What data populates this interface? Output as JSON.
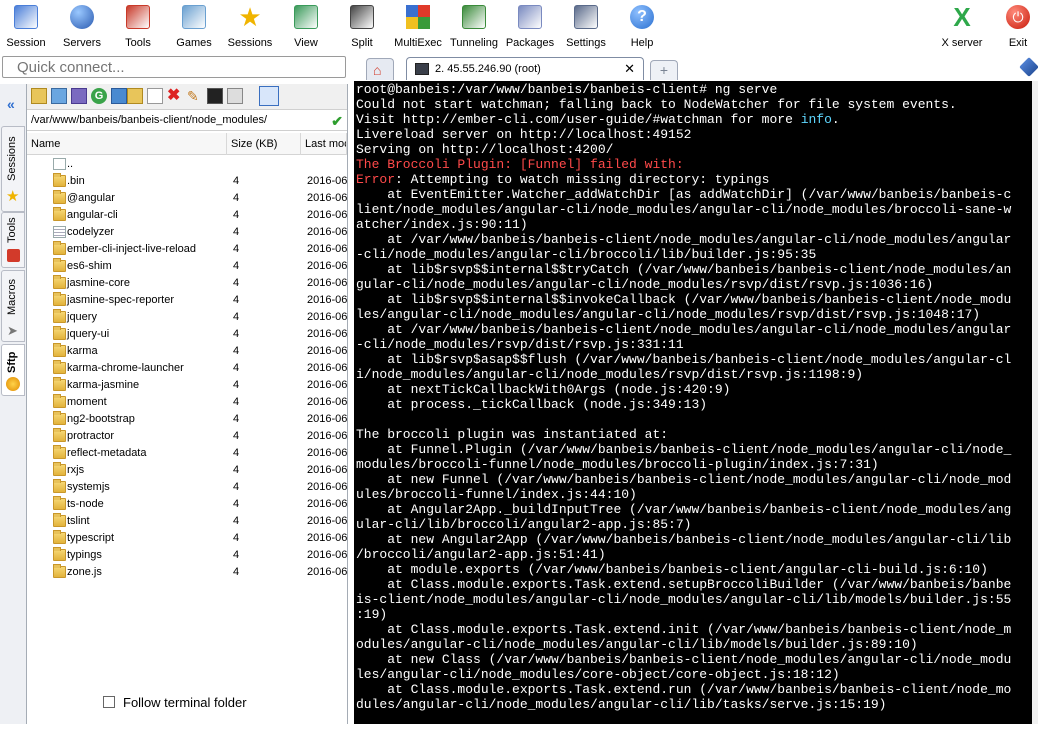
{
  "toolbar": [
    {
      "label": "Session",
      "icon": "session-icon"
    },
    {
      "label": "Servers",
      "icon": "servers-icon"
    },
    {
      "label": "Tools",
      "icon": "tools-icon"
    },
    {
      "label": "Games",
      "icon": "games-icon"
    },
    {
      "label": "Sessions",
      "icon": "star-icon"
    },
    {
      "label": "View",
      "icon": "view-icon"
    },
    {
      "label": "Split",
      "icon": "split-icon"
    },
    {
      "label": "MultiExec",
      "icon": "multiexec-icon"
    },
    {
      "label": "Tunneling",
      "icon": "tunneling-icon"
    },
    {
      "label": "Packages",
      "icon": "packages-icon"
    },
    {
      "label": "Settings",
      "icon": "settings-icon"
    },
    {
      "label": "Help",
      "icon": "help-icon"
    }
  ],
  "toolbar_right": [
    {
      "label": "X server",
      "icon": "x-server-icon"
    },
    {
      "label": "Exit",
      "icon": "exit-icon"
    }
  ],
  "quick_connect": {
    "placeholder": "Quick connect..."
  },
  "side_tabs": [
    "Sessions",
    "Tools",
    "Macros",
    "Sftp"
  ],
  "sftp": {
    "path": "/var/www/banbeis/banbeis-client/node_modules/",
    "columns": {
      "name": "Name",
      "size": "Size (KB)",
      "modified": "Last moc"
    },
    "parent": "..",
    "rows": [
      {
        "name": ".bin",
        "size": "4",
        "date": "2016-06"
      },
      {
        "name": "@angular",
        "size": "4",
        "date": "2016-06"
      },
      {
        "name": "angular-cli",
        "size": "4",
        "date": "2016-06"
      },
      {
        "name": "codelyzer",
        "size": "4",
        "date": "2016-06"
      },
      {
        "name": "ember-cli-inject-live-reload",
        "size": "4",
        "date": "2016-06"
      },
      {
        "name": "es6-shim",
        "size": "4",
        "date": "2016-06"
      },
      {
        "name": "jasmine-core",
        "size": "4",
        "date": "2016-06"
      },
      {
        "name": "jasmine-spec-reporter",
        "size": "4",
        "date": "2016-06"
      },
      {
        "name": "jquery",
        "size": "4",
        "date": "2016-06"
      },
      {
        "name": "jquery-ui",
        "size": "4",
        "date": "2016-06"
      },
      {
        "name": "karma",
        "size": "4",
        "date": "2016-06"
      },
      {
        "name": "karma-chrome-launcher",
        "size": "4",
        "date": "2016-06"
      },
      {
        "name": "karma-jasmine",
        "size": "4",
        "date": "2016-06"
      },
      {
        "name": "moment",
        "size": "4",
        "date": "2016-06"
      },
      {
        "name": "ng2-bootstrap",
        "size": "4",
        "date": "2016-06"
      },
      {
        "name": "protractor",
        "size": "4",
        "date": "2016-06"
      },
      {
        "name": "reflect-metadata",
        "size": "4",
        "date": "2016-06"
      },
      {
        "name": "rxjs",
        "size": "4",
        "date": "2016-06"
      },
      {
        "name": "systemjs",
        "size": "4",
        "date": "2016-06"
      },
      {
        "name": "ts-node",
        "size": "4",
        "date": "2016-06"
      },
      {
        "name": "tslint",
        "size": "4",
        "date": "2016-06"
      },
      {
        "name": "typescript",
        "size": "4",
        "date": "2016-06"
      },
      {
        "name": "typings",
        "size": "4",
        "date": "2016-06"
      },
      {
        "name": "zone.js",
        "size": "4",
        "date": "2016-06"
      }
    ],
    "follow_label": "Follow terminal folder"
  },
  "tabs": {
    "active": "2. 45.55.246.90 (root)"
  },
  "terminal": [
    {
      "t": "root@banbeis:/var/www/banbeis/banbeis-client# ng serve"
    },
    {
      "t": "Could not start watchman; falling back to NodeWatcher for file system events."
    },
    {
      "t": "Visit http://ember-cli.com/user-guide/#watchman for more ",
      "tail": "info",
      "end": "."
    },
    {
      "t": "Livereload server on http://localhost:49152"
    },
    {
      "t": "Serving on http://localhost:4200/"
    },
    {
      "t": "The Broccoli Plugin: [Funnel] failed with:",
      "c": "red"
    },
    {
      "t": "",
      "head": "Error",
      "rest": ": Attempting to watch missing directory: typings"
    },
    {
      "t": "    at EventEmitter.Watcher_addWatchDir [as addWatchDir] (/var/www/banbeis/banbeis-c"
    },
    {
      "t": "lient/node_modules/angular-cli/node_modules/angular-cli/node_modules/broccoli-sane-w"
    },
    {
      "t": "atcher/index.js:90:11)"
    },
    {
      "t": "    at /var/www/banbeis/banbeis-client/node_modules/angular-cli/node_modules/angular"
    },
    {
      "t": "-cli/node_modules/angular-cli/broccoli/lib/builder.js:95:35"
    },
    {
      "t": "    at lib$rsvp$$internal$$tryCatch (/var/www/banbeis/banbeis-client/node_modules/an"
    },
    {
      "t": "gular-cli/node_modules/angular-cli/node_modules/rsvp/dist/rsvp.js:1036:16)"
    },
    {
      "t": "    at lib$rsvp$$internal$$invokeCallback (/var/www/banbeis/banbeis-client/node_modu"
    },
    {
      "t": "les/angular-cli/node_modules/angular-cli/node_modules/rsvp/dist/rsvp.js:1048:17)"
    },
    {
      "t": "    at /var/www/banbeis/banbeis-client/node_modules/angular-cli/node_modules/angular"
    },
    {
      "t": "-cli/node_modules/rsvp/dist/rsvp.js:331:11"
    },
    {
      "t": "    at lib$rsvp$asap$$flush (/var/www/banbeis/banbeis-client/node_modules/angular-cl"
    },
    {
      "t": "i/node_modules/angular-cli/node_modules/rsvp/dist/rsvp.js:1198:9)"
    },
    {
      "t": "    at nextTickCallbackWith0Args (node.js:420:9)"
    },
    {
      "t": "    at process._tickCallback (node.js:349:13)"
    },
    {
      "t": ""
    },
    {
      "t": "The broccoli plugin was instantiated at:"
    },
    {
      "t": "    at Funnel.Plugin (/var/www/banbeis/banbeis-client/node_modules/angular-cli/node_"
    },
    {
      "t": "modules/broccoli-funnel/node_modules/broccoli-plugin/index.js:7:31)"
    },
    {
      "t": "    at new Funnel (/var/www/banbeis/banbeis-client/node_modules/angular-cli/node_mod"
    },
    {
      "t": "ules/broccoli-funnel/index.js:44:10)"
    },
    {
      "t": "    at Angular2App._buildInputTree (/var/www/banbeis/banbeis-client/node_modules/ang"
    },
    {
      "t": "ular-cli/lib/broccoli/angular2-app.js:85:7)"
    },
    {
      "t": "    at new Angular2App (/var/www/banbeis/banbeis-client/node_modules/angular-cli/lib"
    },
    {
      "t": "/broccoli/angular2-app.js:51:41)"
    },
    {
      "t": "    at module.exports (/var/www/banbeis/banbeis-client/angular-cli-build.js:6:10)"
    },
    {
      "t": "    at Class.module.exports.Task.extend.setupBroccoliBuilder (/var/www/banbeis/banbe"
    },
    {
      "t": "is-client/node_modules/angular-cli/node_modules/angular-cli/lib/models/builder.js:55"
    },
    {
      "t": ":19)"
    },
    {
      "t": "    at Class.module.exports.Task.extend.init (/var/www/banbeis/banbeis-client/node_m"
    },
    {
      "t": "odules/angular-cli/node_modules/angular-cli/lib/models/builder.js:89:10)"
    },
    {
      "t": "    at new Class (/var/www/banbeis/banbeis-client/node_modules/angular-cli/node_modu"
    },
    {
      "t": "les/angular-cli/node_modules/core-object/core-object.js:18:12)"
    },
    {
      "t": "    at Class.module.exports.Task.extend.run (/var/www/banbeis/banbeis-client/node_mo"
    },
    {
      "t": "dules/angular-cli/node_modules/angular-cli/lib/tasks/serve.js:15:19)"
    }
  ]
}
